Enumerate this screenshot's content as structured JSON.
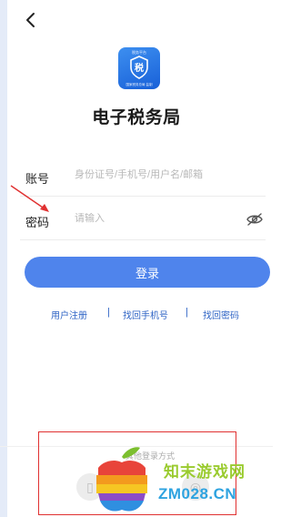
{
  "logo": {
    "top_text": "税务平台",
    "badge_char": "税",
    "bottom_text": "国家税务总局 监制"
  },
  "title": "电子税务局",
  "account": {
    "label": "账号",
    "placeholder": "身份证号/手机号/用户名/邮箱"
  },
  "password": {
    "label": "密码",
    "placeholder": "请输入"
  },
  "login_button": "登录",
  "links": {
    "register": "用户注册",
    "separator": "|",
    "find_phone": "找回手机号",
    "find_password": "找回密码"
  },
  "other_login": {
    "label": "其他登录方式"
  },
  "watermark": {
    "site_name": "知末游戏网",
    "site_url": "ZM028.CN"
  },
  "colors": {
    "accent": "#4f84ec",
    "link": "#2f64c5",
    "annotation": "#e03131"
  }
}
